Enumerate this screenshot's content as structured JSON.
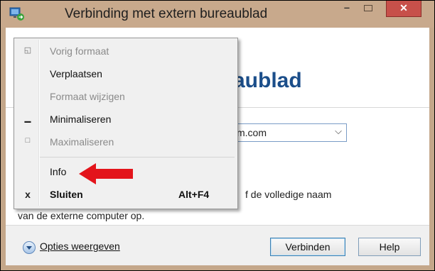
{
  "window": {
    "title": "Verbinding met extern bureaublad",
    "min_glyph": "‒",
    "close_glyph": "✕"
  },
  "header": {
    "visible_text": "aublad"
  },
  "computer": {
    "value": "m.com"
  },
  "hints": {
    "line1": "f de volledige naam",
    "line2": "van de externe computer op."
  },
  "bottom": {
    "options_label": "Opties weergeven",
    "connect_label": "Verbinden",
    "help_label": "Help"
  },
  "menu": {
    "items": [
      {
        "label": "Vorig formaat",
        "icon": "restore-icon",
        "glyph": "◱",
        "enabled": false
      },
      {
        "label": "Verplaatsen",
        "icon": "",
        "glyph": "",
        "enabled": true
      },
      {
        "label": "Formaat wijzigen",
        "icon": "",
        "glyph": "",
        "enabled": false
      },
      {
        "label": "Minimaliseren",
        "icon": "minimize-icon",
        "glyph": "▁",
        "enabled": true
      },
      {
        "label": "Maximaliseren",
        "icon": "maximize-icon",
        "glyph": "□",
        "enabled": false
      },
      {
        "label": "Info",
        "icon": "",
        "glyph": "",
        "enabled": true
      },
      {
        "label": "Sluiten",
        "icon": "close-icon",
        "glyph": "x",
        "enabled": true,
        "shortcut": "Alt+F4"
      }
    ]
  },
  "annotation": {
    "arrow_color": "#e3141b"
  },
  "colors": {
    "titlebar": "#c8a98c",
    "close_button": "#c7504a",
    "header_text": "#1b4e8a"
  }
}
